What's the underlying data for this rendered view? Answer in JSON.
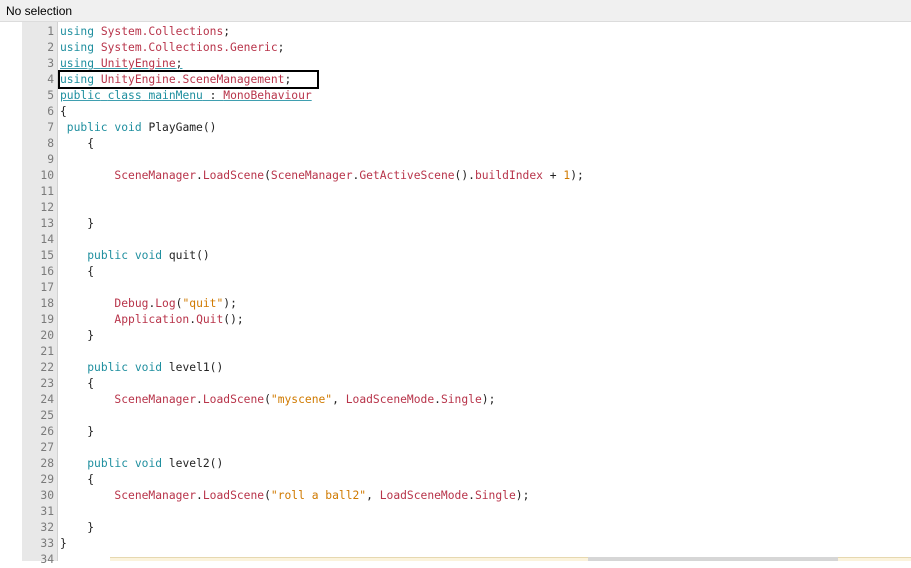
{
  "topbar": {
    "title": "No selection"
  },
  "editor": {
    "lines": [
      {
        "n": "1",
        "tokens": [
          {
            "t": "using",
            "c": "kw"
          },
          {
            "t": " ",
            "c": "pl"
          },
          {
            "t": "System.Collections",
            "c": "ns"
          },
          {
            "t": ";",
            "c": "pl"
          }
        ]
      },
      {
        "n": "2",
        "tokens": [
          {
            "t": "using",
            "c": "kw"
          },
          {
            "t": " ",
            "c": "pl"
          },
          {
            "t": "System.Collections.Generic",
            "c": "ns"
          },
          {
            "t": ";",
            "c": "pl"
          }
        ]
      },
      {
        "n": "3",
        "tokens": [
          {
            "t": "using",
            "c": "kw ul"
          },
          {
            "t": " ",
            "c": "pl ul"
          },
          {
            "t": "UnityEngine",
            "c": "ns ul"
          },
          {
            "t": ";",
            "c": "pl ul"
          }
        ]
      },
      {
        "n": "4",
        "tokens": [
          {
            "t": "using",
            "c": "kw"
          },
          {
            "t": " ",
            "c": "pl"
          },
          {
            "t": "UnityEngine.SceneManagement",
            "c": "ns"
          },
          {
            "t": ";",
            "c": "pl"
          }
        ]
      },
      {
        "n": "5",
        "tokens": [
          {
            "t": "public",
            "c": "kw ul"
          },
          {
            "t": " ",
            "c": "pl ul"
          },
          {
            "t": "class",
            "c": "kw ul"
          },
          {
            "t": " ",
            "c": "pl ul"
          },
          {
            "t": "mainMenu",
            "c": "kw ul"
          },
          {
            "t": " : ",
            "c": "pl ul"
          },
          {
            "t": "MonoBehaviour",
            "c": "typ ul"
          }
        ]
      },
      {
        "n": "6",
        "tokens": [
          {
            "t": "{",
            "c": "pl"
          }
        ]
      },
      {
        "n": "7",
        "tokens": [
          {
            "t": " public",
            "c": "kw"
          },
          {
            "t": " ",
            "c": "pl"
          },
          {
            "t": "void",
            "c": "kw"
          },
          {
            "t": " PlayGame()",
            "c": "pl"
          }
        ]
      },
      {
        "n": "8",
        "tokens": [
          {
            "t": "    {",
            "c": "pl"
          }
        ]
      },
      {
        "n": "9",
        "tokens": []
      },
      {
        "n": "10",
        "tokens": [
          {
            "t": "        ",
            "c": "pl"
          },
          {
            "t": "SceneManager",
            "c": "id"
          },
          {
            "t": ".",
            "c": "pl"
          },
          {
            "t": "LoadScene",
            "c": "mth"
          },
          {
            "t": "(",
            "c": "pl"
          },
          {
            "t": "SceneManager",
            "c": "id"
          },
          {
            "t": ".",
            "c": "pl"
          },
          {
            "t": "GetActiveScene",
            "c": "mth"
          },
          {
            "t": "().",
            "c": "pl"
          },
          {
            "t": "buildIndex",
            "c": "mth"
          },
          {
            "t": " + ",
            "c": "pl"
          },
          {
            "t": "1",
            "c": "num"
          },
          {
            "t": ");",
            "c": "pl"
          }
        ]
      },
      {
        "n": "11",
        "tokens": []
      },
      {
        "n": "12",
        "tokens": []
      },
      {
        "n": "13",
        "tokens": [
          {
            "t": "    }",
            "c": "pl"
          }
        ]
      },
      {
        "n": "14",
        "tokens": []
      },
      {
        "n": "15",
        "tokens": [
          {
            "t": "    ",
            "c": "pl"
          },
          {
            "t": "public",
            "c": "kw"
          },
          {
            "t": " ",
            "c": "pl"
          },
          {
            "t": "void",
            "c": "kw"
          },
          {
            "t": " quit()",
            "c": "pl"
          }
        ]
      },
      {
        "n": "16",
        "tokens": [
          {
            "t": "    {",
            "c": "pl"
          }
        ]
      },
      {
        "n": "17",
        "tokens": []
      },
      {
        "n": "18",
        "tokens": [
          {
            "t": "        ",
            "c": "pl"
          },
          {
            "t": "Debug",
            "c": "id"
          },
          {
            "t": ".",
            "c": "pl"
          },
          {
            "t": "Log",
            "c": "mth"
          },
          {
            "t": "(",
            "c": "pl"
          },
          {
            "t": "\"quit\"",
            "c": "str"
          },
          {
            "t": ");",
            "c": "pl"
          }
        ]
      },
      {
        "n": "19",
        "tokens": [
          {
            "t": "        ",
            "c": "pl"
          },
          {
            "t": "Application",
            "c": "id"
          },
          {
            "t": ".",
            "c": "pl"
          },
          {
            "t": "Quit",
            "c": "mth"
          },
          {
            "t": "();",
            "c": "pl"
          }
        ]
      },
      {
        "n": "20",
        "tokens": [
          {
            "t": "    }",
            "c": "pl"
          }
        ]
      },
      {
        "n": "21",
        "tokens": []
      },
      {
        "n": "22",
        "tokens": [
          {
            "t": "    ",
            "c": "pl"
          },
          {
            "t": "public",
            "c": "kw"
          },
          {
            "t": " ",
            "c": "pl"
          },
          {
            "t": "void",
            "c": "kw"
          },
          {
            "t": " level1()",
            "c": "pl"
          }
        ]
      },
      {
        "n": "23",
        "tokens": [
          {
            "t": "    {",
            "c": "pl"
          }
        ]
      },
      {
        "n": "24",
        "tokens": [
          {
            "t": "        ",
            "c": "pl"
          },
          {
            "t": "SceneManager",
            "c": "id"
          },
          {
            "t": ".",
            "c": "pl"
          },
          {
            "t": "LoadScene",
            "c": "mth"
          },
          {
            "t": "(",
            "c": "pl"
          },
          {
            "t": "\"myscene\"",
            "c": "str"
          },
          {
            "t": ", ",
            "c": "pl"
          },
          {
            "t": "LoadSceneMode",
            "c": "id"
          },
          {
            "t": ".",
            "c": "pl"
          },
          {
            "t": "Single",
            "c": "mth"
          },
          {
            "t": ");",
            "c": "pl"
          }
        ]
      },
      {
        "n": "25",
        "tokens": []
      },
      {
        "n": "26",
        "tokens": [
          {
            "t": "    }",
            "c": "pl"
          }
        ]
      },
      {
        "n": "27",
        "tokens": []
      },
      {
        "n": "28",
        "tokens": [
          {
            "t": "    ",
            "c": "pl"
          },
          {
            "t": "public",
            "c": "kw"
          },
          {
            "t": " ",
            "c": "pl"
          },
          {
            "t": "void",
            "c": "kw"
          },
          {
            "t": " level2()",
            "c": "pl"
          }
        ]
      },
      {
        "n": "29",
        "tokens": [
          {
            "t": "    {",
            "c": "pl"
          }
        ]
      },
      {
        "n": "30",
        "tokens": [
          {
            "t": "        ",
            "c": "pl"
          },
          {
            "t": "SceneManager",
            "c": "id"
          },
          {
            "t": ".",
            "c": "pl"
          },
          {
            "t": "LoadScene",
            "c": "mth"
          },
          {
            "t": "(",
            "c": "pl"
          },
          {
            "t": "\"roll a ball2\"",
            "c": "str"
          },
          {
            "t": ", ",
            "c": "pl"
          },
          {
            "t": "LoadSceneMode",
            "c": "id"
          },
          {
            "t": ".",
            "c": "pl"
          },
          {
            "t": "Single",
            "c": "mth"
          },
          {
            "t": ");",
            "c": "pl"
          }
        ]
      },
      {
        "n": "31",
        "tokens": []
      },
      {
        "n": "32",
        "tokens": [
          {
            "t": "    }",
            "c": "pl"
          }
        ]
      },
      {
        "n": "33",
        "tokens": [
          {
            "t": "}",
            "c": "pl"
          }
        ]
      },
      {
        "n": "34",
        "tokens": []
      }
    ],
    "highlighted_line": "4"
  },
  "colors": {
    "keyword": "#1f8f9f",
    "identifier": "#b8344a",
    "string": "#d07a00",
    "gutter_bg": "#e8e8e8",
    "topbar_bg": "#f0f0f0"
  }
}
